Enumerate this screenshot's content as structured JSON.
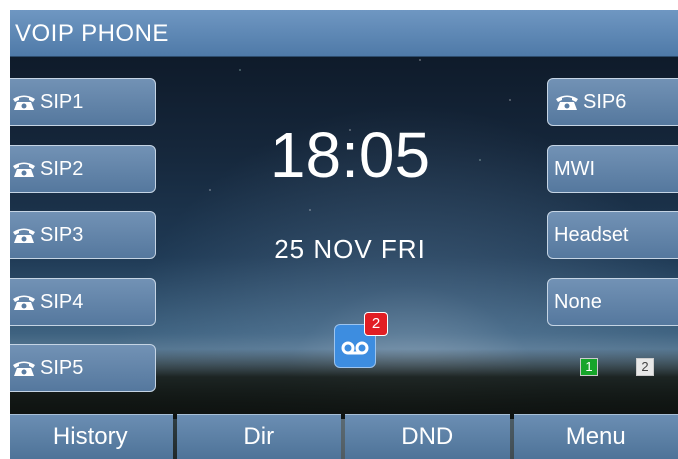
{
  "header": {
    "title": "VOIP  PHONE"
  },
  "left_lines": [
    {
      "label": "SIP1",
      "icon": "phone-icon"
    },
    {
      "label": "SIP2",
      "icon": "phone-icon"
    },
    {
      "label": "SIP3",
      "icon": "phone-icon"
    },
    {
      "label": "SIP4",
      "icon": "phone-icon"
    },
    {
      "label": "SIP5",
      "icon": "phone-icon"
    }
  ],
  "right_lines": [
    {
      "label": "SIP6",
      "icon": "phone-icon"
    },
    {
      "label": "MWI"
    },
    {
      "label": "Headset"
    },
    {
      "label": "None"
    }
  ],
  "clock": {
    "time": "18:05",
    "date": "25  NOV  FRI"
  },
  "voicemail": {
    "icon": "voicemail-icon",
    "count": "2"
  },
  "accounts": [
    {
      "number": "1",
      "color": "#16a52a"
    },
    {
      "number": "2",
      "color": "#e8e8e8"
    }
  ],
  "softkeys": [
    "History",
    "Dir",
    "DND",
    "Menu"
  ],
  "colors": {
    "header": "#4f7aa8",
    "button": "#5f82a8",
    "badge": "#e21e24"
  }
}
